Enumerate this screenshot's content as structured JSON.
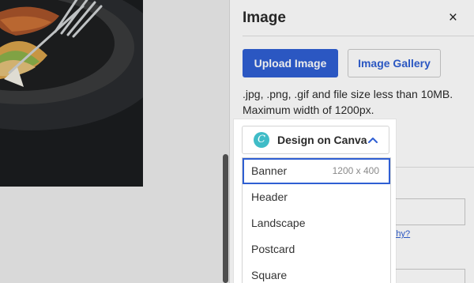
{
  "panel": {
    "title": "Image",
    "close_label": "×",
    "upload_label": "Upload Image",
    "gallery_label": "Image Gallery",
    "hint_line1": ".jpg, .png, .gif and file size less than 10MB.",
    "hint_line2": "Maximum width of 1200px.",
    "why_link": "Why?"
  },
  "canva": {
    "logo_letter": "C",
    "label": "Design on Canva",
    "items": [
      {
        "label": "Banner",
        "dims": "1200 x 400"
      },
      {
        "label": "Header",
        "dims": ""
      },
      {
        "label": "Landscape",
        "dims": ""
      },
      {
        "label": "Postcard",
        "dims": ""
      },
      {
        "label": "Square",
        "dims": ""
      }
    ],
    "selected_index": 0
  },
  "colors": {
    "accent": "#2f5fd3",
    "canva_teal": "#3fbcc7"
  },
  "icons": {
    "close": "close-icon",
    "canva_logo": "canva-logo-icon",
    "chevron": "chevron-up-icon"
  }
}
